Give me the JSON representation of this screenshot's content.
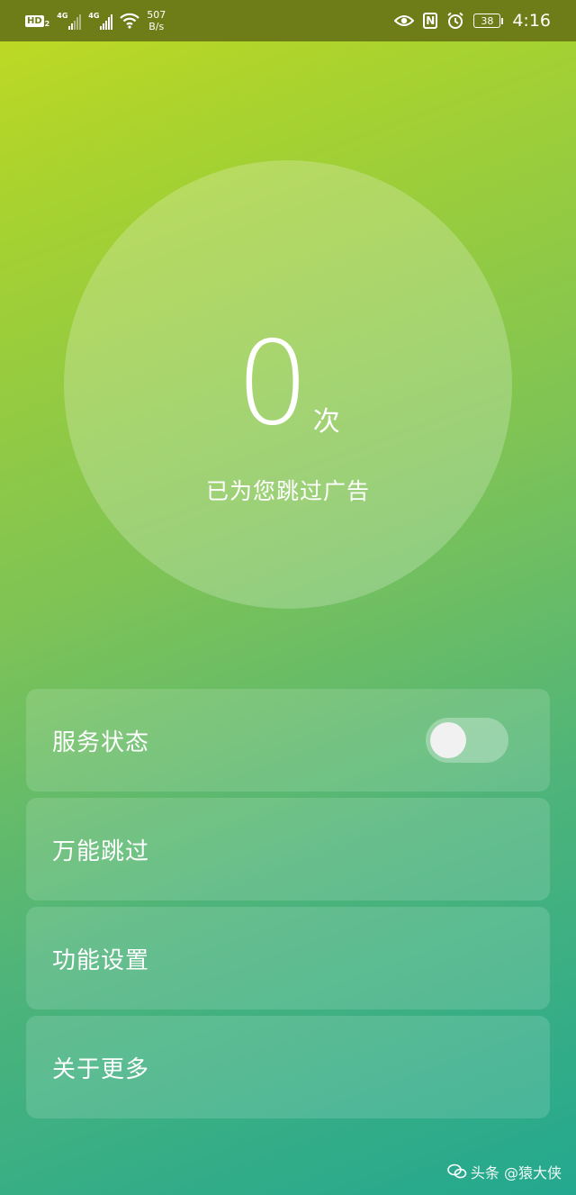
{
  "status_bar": {
    "hd_label": "HD",
    "hd_sub": "2",
    "signal1_tag": "4G",
    "signal2_tag": "4G",
    "net_speed_value": "507",
    "net_speed_unit": "B/s",
    "nfc_label": "N",
    "battery_level": "38",
    "time": "4:16",
    "icons": [
      "eye-icon",
      "nfc-icon",
      "alarm-icon",
      "battery-icon",
      "wifi-icon",
      "signal-icon"
    ]
  },
  "counter": {
    "value": "0",
    "unit": "次",
    "caption": "已为您跳过广告"
  },
  "menu": {
    "items": [
      {
        "label": "服务状态",
        "has_toggle": true,
        "toggle_on": false
      },
      {
        "label": "万能跳过"
      },
      {
        "label": "功能设置"
      },
      {
        "label": "关于更多"
      }
    ]
  },
  "watermark": {
    "text": "头条 @猿大侠"
  },
  "colors": {
    "status_bar_bg": "#6f7d18",
    "gradient_top": "#c2da22",
    "gradient_bottom": "#23a88f"
  }
}
